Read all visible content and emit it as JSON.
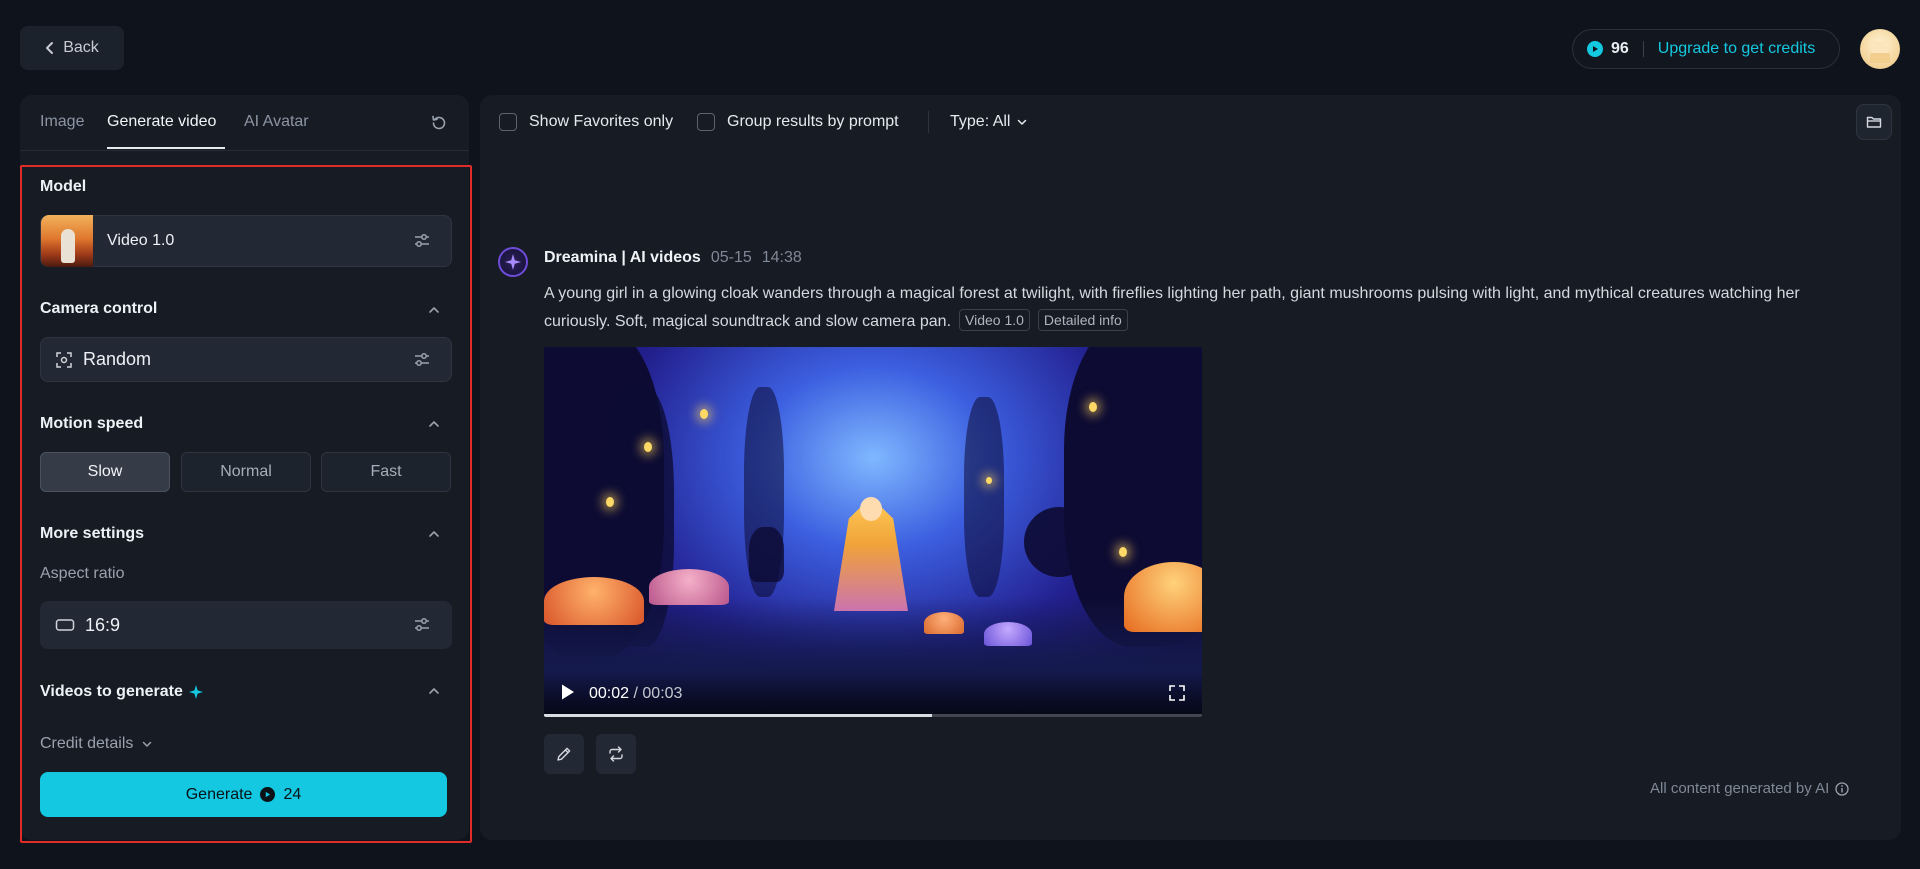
{
  "header": {
    "back_label": "Back",
    "credits": "96",
    "upgrade_label": "Upgrade to get credits"
  },
  "left_panel": {
    "tabs": [
      {
        "label": "Image",
        "active": false
      },
      {
        "label": "Generate video",
        "active": true
      },
      {
        "label": "AI Avatar",
        "active": false
      }
    ],
    "model": {
      "title": "Model",
      "value": "Video 1.0"
    },
    "camera_control": {
      "title": "Camera control",
      "value": "Random"
    },
    "motion_speed": {
      "title": "Motion speed",
      "options": [
        "Slow",
        "Normal",
        "Fast"
      ],
      "selected": "Slow"
    },
    "more_settings": {
      "title": "More settings",
      "aspect_ratio_label": "Aspect ratio",
      "aspect_ratio_value": "16:9"
    },
    "videos_to_generate": {
      "title": "Videos to generate"
    },
    "credit_details_label": "Credit details",
    "generate": {
      "label": "Generate",
      "cost": "24"
    }
  },
  "right_panel": {
    "toolbar": {
      "show_favorites_label": "Show Favorites only",
      "group_by_prompt_label": "Group results by prompt",
      "type_filter_label": "Type: All"
    },
    "result": {
      "author": "Dreamina | AI videos",
      "date": "05-15",
      "time": "14:38",
      "prompt": "A young girl in a glowing cloak wanders through a magical forest at twilight, with fireflies lighting her path, giant mushrooms pulsing with light, and mythical creatures watching her curiously. Soft, magical soundtrack and slow camera pan.",
      "tags": [
        "Video 1.0",
        "Detailed info"
      ],
      "video": {
        "current_time": "00:02",
        "total_time": "00:03",
        "progress_fraction": 0.59
      }
    },
    "footnote": "All content generated by AI"
  },
  "colors": {
    "accent": "#13c8e0",
    "background": "#0f141c",
    "panel": "#161b24",
    "highlight_frame": "#e02b2b"
  },
  "icons": {
    "back": "chevron-left-icon",
    "credits": "coin-icon",
    "reset": "refresh-icon",
    "settings": "sliders-icon",
    "camera": "focus-icon",
    "aspect": "rectangle-icon",
    "collapse": "chevron-up-icon",
    "sparkle": "sparkle-icon",
    "folder": "folder-icon",
    "play": "play-icon",
    "fullscreen": "fullscreen-icon",
    "edit": "pencil-icon",
    "regenerate": "repeat-icon",
    "info": "info-icon"
  }
}
